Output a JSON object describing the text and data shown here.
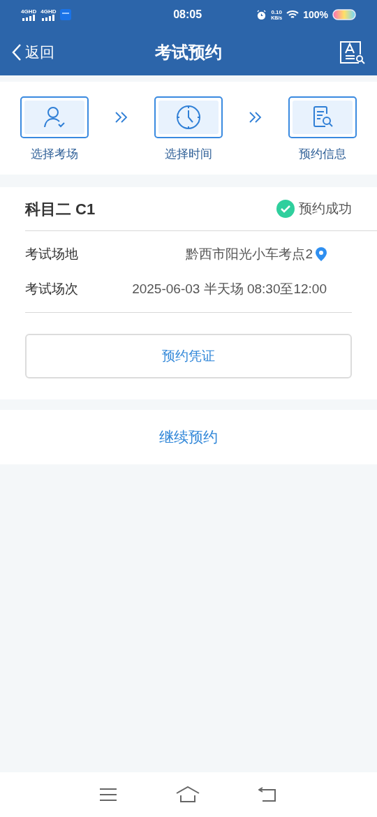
{
  "status_bar": {
    "signals": [
      "4GHD",
      "4GHD"
    ],
    "time": "08:05",
    "speed_value": "0.10",
    "speed_unit": "KB/s",
    "battery": "100%"
  },
  "header": {
    "back": "返回",
    "title": "考试预约"
  },
  "steps": [
    {
      "kind": "person",
      "label": "选择考场"
    },
    {
      "kind": "clock",
      "label": "选择时间"
    },
    {
      "kind": "document",
      "label": "预约信息"
    }
  ],
  "result": {
    "subject": "科目二 C1",
    "status": "预约成功",
    "rows": [
      {
        "label": "考试场地",
        "value": "黔西市阳光小车考点2",
        "location": true
      },
      {
        "label": "考试场次",
        "value": "2025-06-03 半天场 08:30至12:00",
        "location": false
      }
    ],
    "voucher_button": "预约凭证"
  },
  "continue_button": "继续预约"
}
